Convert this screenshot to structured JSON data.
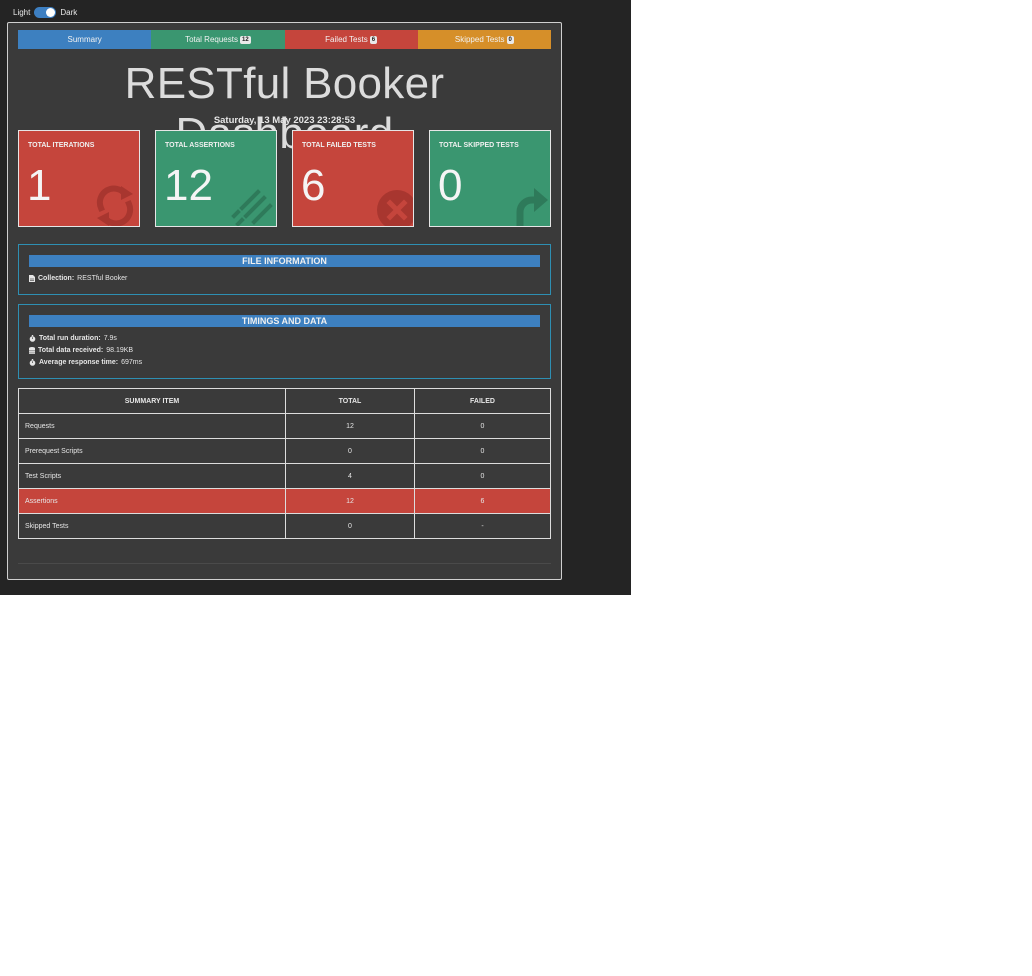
{
  "theme": {
    "light_label": "Light",
    "dark_label": "Dark"
  },
  "tabs": {
    "summary": "Summary",
    "requests": "Total Requests",
    "requests_badge": "12",
    "failed": "Failed Tests",
    "failed_badge": "6",
    "skipped": "Skipped Tests",
    "skipped_badge": "0"
  },
  "dashboard": {
    "title": "RESTful Booker Dashboard",
    "date": "Saturday, 13 May 2023 23:28:53"
  },
  "stats": [
    {
      "label": "TOTAL ITERATIONS",
      "value": "1",
      "icon": "refresh-icon",
      "color": "#c5453c"
    },
    {
      "label": "TOTAL ASSERTIONS",
      "value": "12",
      "icon": "list-check-icon",
      "color": "#3a9670"
    },
    {
      "label": "TOTAL FAILED TESTS",
      "value": "6",
      "icon": "times-circle-icon",
      "color": "#c5453c"
    },
    {
      "label": "TOTAL SKIPPED TESTS",
      "value": "0",
      "icon": "share-icon",
      "color": "#3a9670"
    }
  ],
  "file_info": {
    "heading": "FILE INFORMATION",
    "collection_label": "Collection:",
    "collection_value": "RESTful Booker"
  },
  "timings": {
    "heading": "TIMINGS AND DATA",
    "duration_label": "Total run duration:",
    "duration_value": "7.9s",
    "data_label": "Total data received:",
    "data_value": "98.19KB",
    "response_label": "Average response time:",
    "response_value": "697ms"
  },
  "summary_table": {
    "headers": [
      "SUMMARY ITEM",
      "TOTAL",
      "FAILED"
    ],
    "rows": [
      [
        "Requests",
        "12",
        "0"
      ],
      [
        "Prerequest Scripts",
        "0",
        "0"
      ],
      [
        "Test Scripts",
        "4",
        "0"
      ],
      [
        "Assertions",
        "12",
        "6"
      ],
      [
        "Skipped Tests",
        "0",
        "-"
      ]
    ]
  },
  "colors": {
    "background": "#242424",
    "card": "#3a3a3a",
    "blue": "#3d80c0",
    "green": "#3a9670",
    "red": "#c5453c",
    "orange": "#d68f29",
    "panel_border": "#2e8fb3"
  }
}
